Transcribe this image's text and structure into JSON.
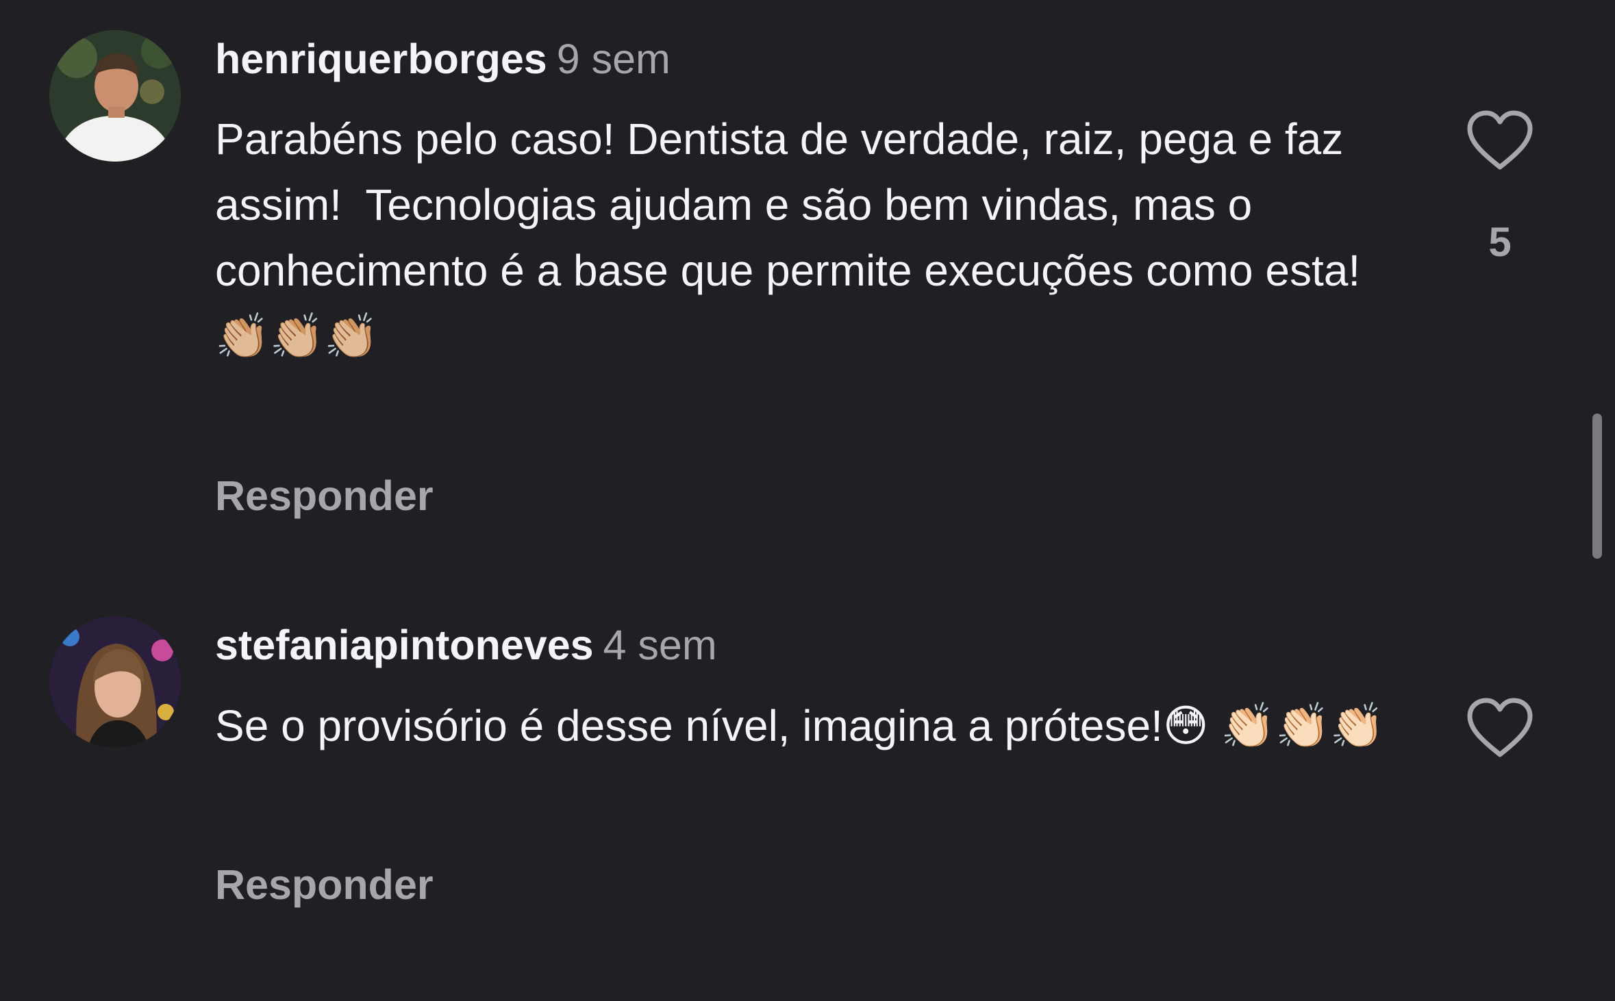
{
  "comments": [
    {
      "username": "henriquerborges",
      "time": "9 sem",
      "text": "Parabéns pelo caso! Dentista de verdade, raiz, pega e faz assim!  Tecnologias ajudam e são bem vindas, mas o conhecimento é a base que permite execuções como esta!👏🏼👏🏼👏🏼",
      "reply_label": "Responder",
      "like_count": "5",
      "like_icon": "heart-outline-icon"
    },
    {
      "username": "stefaniapintoneves",
      "time": "4 sem",
      "text": "Se o provisório é desse nível, imagina a prótese!😳 👏🏻👏🏻👏🏻",
      "reply_label": "Responder",
      "like_icon": "heart-outline-icon"
    }
  ],
  "colors": {
    "background": "#1f1f24",
    "primary_text": "#f5f5f7",
    "secondary_text": "#a6a6ad"
  }
}
